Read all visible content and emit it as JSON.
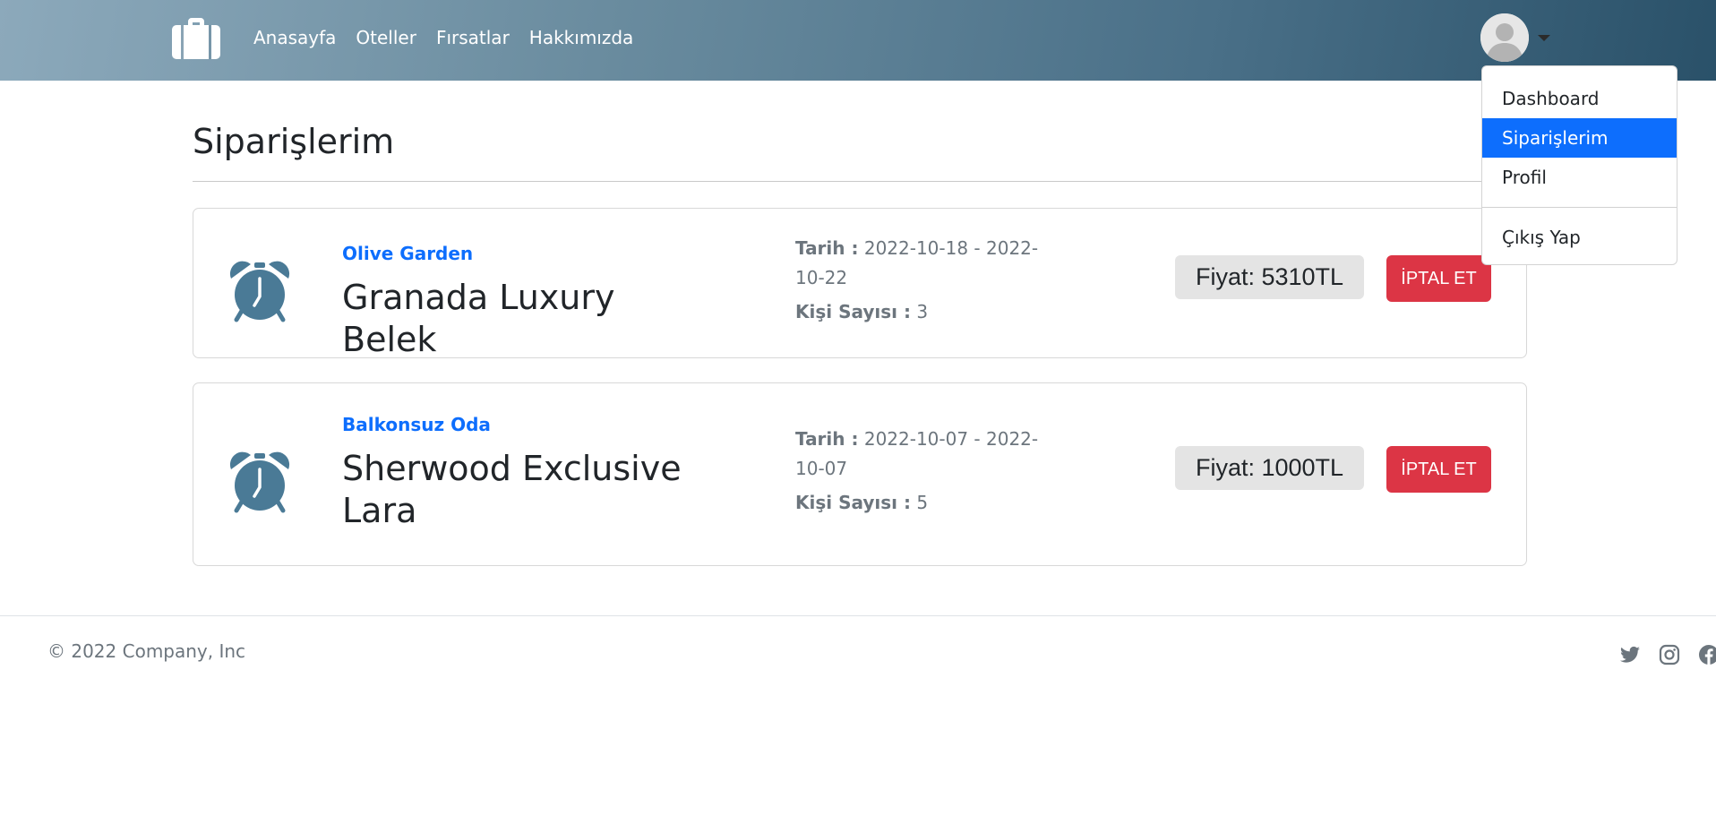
{
  "nav": {
    "links": [
      "Anasayfa",
      "Oteller",
      "Fırsatlar",
      "Hakkımızda"
    ],
    "brand_icon": "briefcase-icon"
  },
  "user_menu": {
    "avatar_icon": "user-avatar-icon",
    "items": [
      "Dashboard",
      "Siparişlerim",
      "Profil"
    ],
    "active_item": "Siparişlerim",
    "logout": "Çıkış Yap"
  },
  "page": {
    "title": "Siparişlerim"
  },
  "orders": [
    {
      "icon": "alarm-clock-icon",
      "room": "Olive Garden",
      "hotel": "Granada Luxury Belek",
      "date_label": "Tarih :",
      "date_value": "2022-10-18 - 2022-10-22",
      "people_label": "Kişi Sayısı :",
      "people_value": "3",
      "price": "Fiyat: 5310TL",
      "cancel_label": "İPTAL ET"
    },
    {
      "icon": "alarm-clock-icon",
      "room": "Balkonsuz Oda",
      "hotel": "Sherwood Exclusive Lara",
      "date_label": "Tarih :",
      "date_value": "2022-10-07 - 2022-10-07",
      "people_label": "Kişi Sayısı :",
      "people_value": "5",
      "price": "Fiyat: 1000TL",
      "cancel_label": "İPTAL ET"
    }
  ],
  "footer": {
    "copyright": "© 2022 Company, Inc",
    "social_icons": [
      "twitter-icon",
      "instagram-icon",
      "facebook-icon"
    ]
  },
  "colors": {
    "accent": "#0d6efd",
    "danger": "#dc3545",
    "icon": "#4a7a96"
  }
}
